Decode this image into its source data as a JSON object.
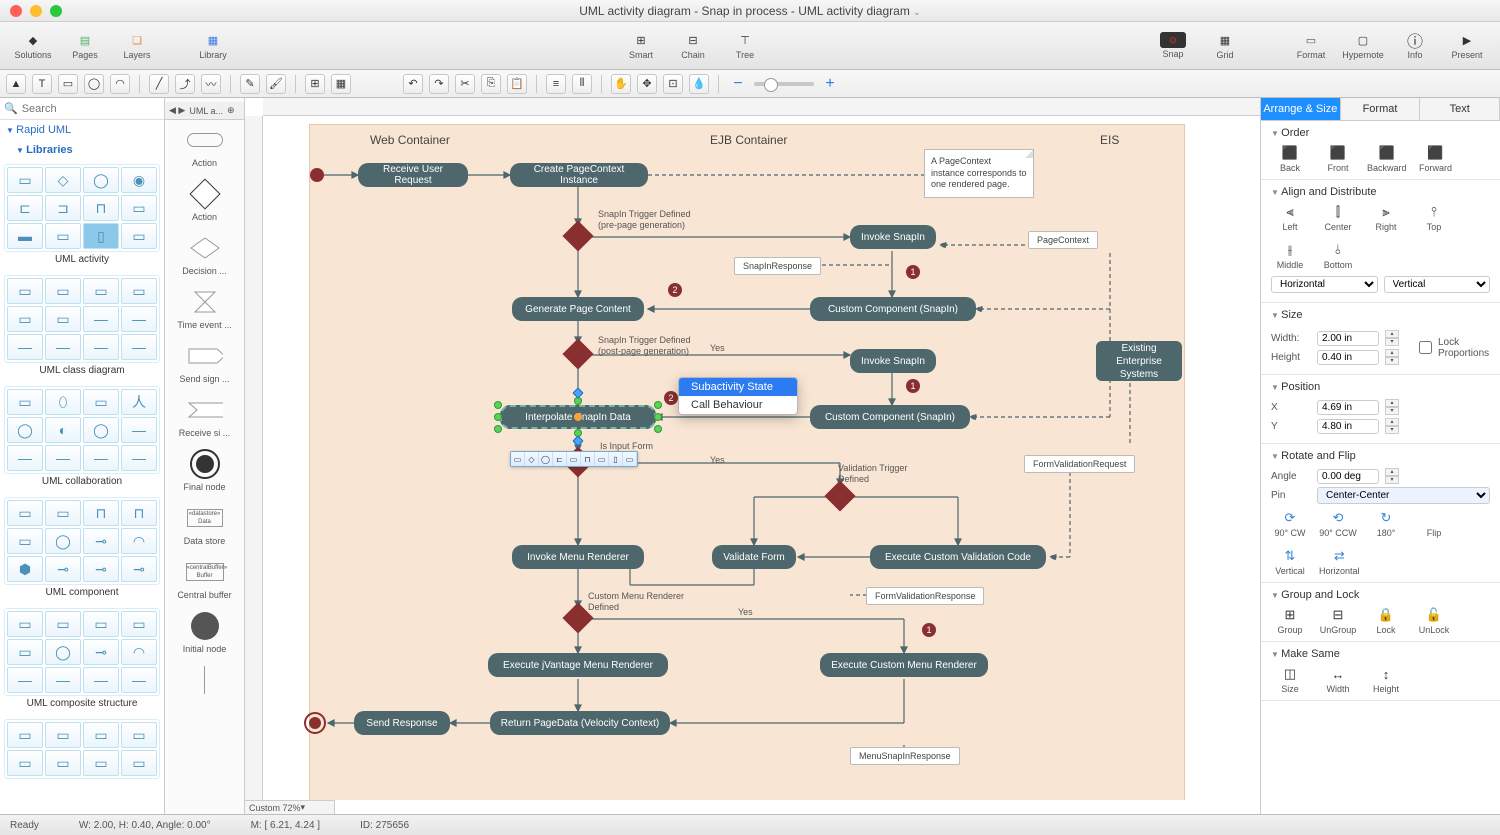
{
  "window": {
    "title": "UML activity diagram - Snap in process - UML activity diagram"
  },
  "toolbar": {
    "solutions": "Solutions",
    "pages": "Pages",
    "layers": "Layers",
    "library": "Library",
    "smart": "Smart",
    "chain": "Chain",
    "tree": "Tree",
    "snap": "Snap",
    "grid": "Grid",
    "format": "Format",
    "hypernote": "Hypernote",
    "info": "Info",
    "present": "Present"
  },
  "left": {
    "search_placeholder": "Search",
    "rapid_uml": "Rapid UML",
    "libraries": "Libraries",
    "groups": [
      "UML activity",
      "UML class diagram",
      "UML collaboration",
      "UML component",
      "UML composite structure"
    ]
  },
  "shapes": {
    "tab": "UML a...",
    "items": [
      "Action",
      "Action",
      "Decision ...",
      "Time event ...",
      "Send sign ...",
      "Receive si ...",
      "Final node",
      "Data store",
      "Central buffer",
      "Initial node"
    ]
  },
  "canvas_zoom": "Custom 72%",
  "diagram": {
    "regions": {
      "web": "Web Container",
      "ejb": "EJB Container",
      "eis": "EIS"
    },
    "nodes": {
      "receive": "Receive User Request",
      "createctx": "Create PageContext Instance",
      "invoke1": "Invoke SnapIn",
      "genpage": "Generate Page Content",
      "custcomp1": "Custom Component (SnapIn)",
      "invoke2": "Invoke SnapIn",
      "custcomp2": "Custom Component (SnapIn)",
      "interpolate": "Interpolate SnapIn Data",
      "existing": "Existing Enterprise Systems",
      "invokemenu": "Invoke Menu Renderer",
      "validate": "Validate Form",
      "execvalid": "Execute Custom Validation Code",
      "jvantage": "Execute jVantage Menu Renderer",
      "custmenu": "Execute Custom Menu Renderer",
      "returnpd": "Return PageData (Velocity Context)",
      "sendresp": "Send Response"
    },
    "objects": {
      "pagectx": "PageContext",
      "snapinresp": "SnapInResponse",
      "formvalreq": "FormValidationRequest",
      "formvalresp": "FormValidationResponse",
      "menusnap": "MenuSnapInResponse"
    },
    "labels": {
      "trig1a": "SnapIn Trigger Defined",
      "trig1b": "(pre-page generation)",
      "trig2a": "SnapIn Trigger Defined",
      "trig2b": "(post-page generation)",
      "yes": "Yes",
      "isform": "Is Input Form",
      "valtrig1": "Validation Trigger",
      "valtrig2": "Defined",
      "custmenu1": "Custom Menu Renderer",
      "custmenu2": "Defined"
    },
    "note": "A PageContext instance corresponds to one rendered page.",
    "context_menu": {
      "subactivity": "Subactivity State",
      "callbeh": "Call Behaviour"
    }
  },
  "right": {
    "tabs": {
      "arrange": "Arrange & Size",
      "format": "Format",
      "text": "Text"
    },
    "order": {
      "h": "Order",
      "back": "Back",
      "front": "Front",
      "backward": "Backward",
      "forward": "Forward"
    },
    "align": {
      "h": "Align and Distribute",
      "left": "Left",
      "center": "Center",
      "right": "Right",
      "top": "Top",
      "middle": "Middle",
      "bottom": "Bottom",
      "horiz": "Horizontal",
      "vert": "Vertical"
    },
    "size": {
      "h": "Size",
      "width_l": "Width:",
      "width": "2.00 in",
      "height_l": "Height",
      "height": "0.40 in",
      "lock": "Lock Proportions"
    },
    "pos": {
      "h": "Position",
      "x_l": "X",
      "x": "4.69 in",
      "y_l": "Y",
      "y": "4.80 in"
    },
    "rotate": {
      "h": "Rotate and Flip",
      "angle_l": "Angle",
      "angle": "0.00 deg",
      "pin_l": "Pin",
      "pin": "Center-Center",
      "cw": "90° CW",
      "ccw": "90° CCW",
      "r180": "180°",
      "flip": "Flip",
      "fvert": "Vertical",
      "fhoriz": "Horizontal"
    },
    "group": {
      "h": "Group and Lock",
      "group": "Group",
      "ungroup": "UnGroup",
      "lock": "Lock",
      "unlock": "UnLock"
    },
    "same": {
      "h": "Make Same",
      "size": "Size",
      "width": "Width",
      "height": "Height"
    }
  },
  "status": {
    "ready": "Ready",
    "wh": "W: 2.00,  H: 0.40,  Angle: 0.00°",
    "m": "M: [ 6.21, 4.24 ]",
    "id": "ID: 275656"
  }
}
